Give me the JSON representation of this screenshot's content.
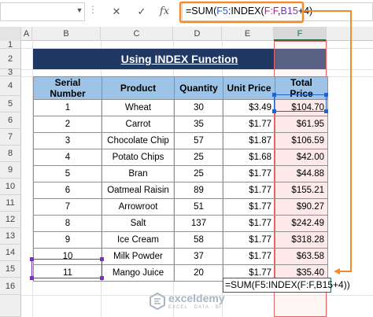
{
  "formula_bar": {
    "name_box": "",
    "icons": [
      "close-icon",
      "check-icon",
      "fx-icon"
    ],
    "formula_parts": [
      "=SUM(",
      "F5",
      ":INDEX(",
      "F:F",
      ",",
      "B15",
      "+4)"
    ]
  },
  "columns": [
    "A",
    "B",
    "C",
    "D",
    "E",
    "F"
  ],
  "rows": [
    "1",
    "2",
    "3",
    "4",
    "5",
    "6",
    "7",
    "8",
    "9",
    "10",
    "11",
    "12",
    "13",
    "14",
    "15",
    "16"
  ],
  "title": "Using INDEX Function",
  "table": {
    "headers": [
      "Serial Number",
      "Product",
      "Quantity",
      "Unit Price",
      "Total Price"
    ],
    "rows": [
      [
        "1",
        "Wheat",
        "30",
        "$3.49",
        "$104.70"
      ],
      [
        "2",
        "Carrot",
        "35",
        "$1.77",
        "$61.95"
      ],
      [
        "3",
        "Chocolate Chip",
        "57",
        "$1.87",
        "$106.59"
      ],
      [
        "4",
        "Potato Chips",
        "25",
        "$1.68",
        "$42.00"
      ],
      [
        "5",
        "Bran",
        "25",
        "$1.77",
        "$44.88"
      ],
      [
        "6",
        "Oatmeal Raisin",
        "89",
        "$1.77",
        "$155.21"
      ],
      [
        "7",
        "Arrowroot",
        "51",
        "$1.77",
        "$90.27"
      ],
      [
        "8",
        "Salt",
        "137",
        "$1.77",
        "$242.49"
      ],
      [
        "9",
        "Ice Cream",
        "58",
        "$1.77",
        "$318.28"
      ],
      [
        "10",
        "Milk Powder",
        "37",
        "$1.77",
        "$63.58"
      ],
      [
        "11",
        "Mango Juice",
        "20",
        "$1.77",
        "$35.40"
      ]
    ]
  },
  "cell_formula": "=SUM(F5:INDEX(F:F,B15+4))",
  "watermark": {
    "name": "exceldemy",
    "tagline": "EXCEL · DATA · BI"
  },
  "colors": {
    "title_bg": "#203864",
    "header_bg": "#9dc3e6",
    "excel_green": "#217346",
    "callout": "#f28c28"
  }
}
